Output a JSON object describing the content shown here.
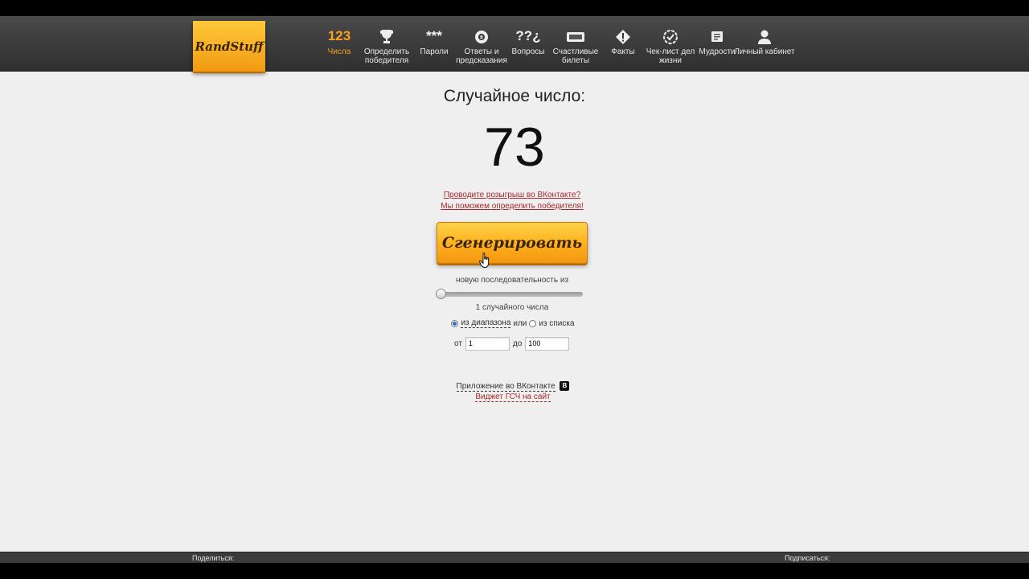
{
  "header": {
    "logo_text": "RandStuff",
    "nav": [
      {
        "icon": "numbers-icon",
        "icon_text": "123",
        "label": "Числа",
        "active": true
      },
      {
        "icon": "trophy-icon",
        "label": "Определить победителя"
      },
      {
        "icon": "asterisks-icon",
        "icon_text": "***",
        "label": "Пароли"
      },
      {
        "icon": "magic-ball-icon",
        "label": "Ответы и предсказания"
      },
      {
        "icon": "question-marks-icon",
        "icon_text": "??¿",
        "label": "Вопросы"
      },
      {
        "icon": "ticket-icon",
        "label": "Счастливые билеты"
      },
      {
        "icon": "warning-diamond-icon",
        "label": "Факты"
      },
      {
        "icon": "check-badge-icon",
        "label": "Чек-лист дел жизни"
      },
      {
        "icon": "scroll-icon",
        "label": "Мудрости"
      },
      {
        "icon": "user-icon",
        "label": "Личный кабинет"
      }
    ]
  },
  "main": {
    "title": "Случайное число:",
    "number": "73",
    "promo_line1": "Проводите розыгрыш во ВКонтакте?",
    "promo_line2": "Мы поможем определить победителя!",
    "generate_button": "Сгенерировать",
    "sequence_label": "новую последовательность из",
    "count_label": "1 случайного числа",
    "radio_range_label": "из диапазона",
    "or_text": "или",
    "radio_list_label": "из списка",
    "from_label": "от",
    "from_value": "1",
    "to_label": "до",
    "to_value": "100",
    "vk_app_link": "Приложение во ВКонтакте",
    "vk_badge": "В",
    "widget_link": "Виджет ГСЧ на сайт"
  },
  "footer": {
    "share_label": "Поделиться:",
    "subscribe_label": "Подписаться:"
  },
  "colors": {
    "accent_orange": "#f7a21b",
    "link_red": "#a8272d",
    "header_dark": "#3a3a3a"
  }
}
